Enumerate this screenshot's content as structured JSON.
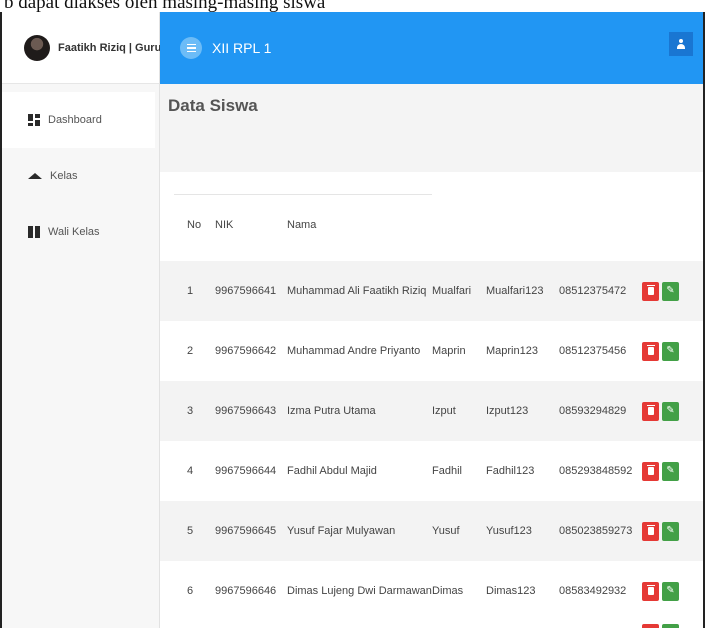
{
  "caption": "b dapat diakses oleh masing-masing siswa",
  "sidebar": {
    "profile_name": "Faatikh Riziq | Guru",
    "items": [
      {
        "label": "Dashboard",
        "icon": "dashboard-icon"
      },
      {
        "label": "Kelas",
        "icon": "graduation-cap-icon"
      },
      {
        "label": "Wali Kelas",
        "icon": "columns-icon"
      }
    ]
  },
  "header": {
    "title": "XII RPL 1",
    "menu_icon": "menu-icon",
    "user_icon": "user-icon",
    "accent_color": "#2196f3"
  },
  "main": {
    "page_title": "Data Siswa",
    "table": {
      "columns": [
        "No",
        "NIK",
        "Nama"
      ],
      "rows": [
        {
          "no": "1",
          "nik": "9967596641",
          "nama": "Muhammad Ali Faatikh Riziq",
          "username": "Mualfari",
          "password": "Mualfari123",
          "telp": "08512375472"
        },
        {
          "no": "2",
          "nik": "9967596642",
          "nama": "Muhammad Andre Priyanto",
          "username": "Maprin",
          "password": "Maprin123",
          "telp": "08512375456"
        },
        {
          "no": "3",
          "nik": "9967596643",
          "nama": "Izma Putra Utama",
          "username": "Izput",
          "password": "Izput123",
          "telp": "08593294829"
        },
        {
          "no": "4",
          "nik": "9967596644",
          "nama": "Fadhil Abdul Majid",
          "username": "Fadhil",
          "password": "Fadhil123",
          "telp": "085293848592"
        },
        {
          "no": "5",
          "nik": "9967596645",
          "nama": "Yusuf Fajar Mulyawan",
          "username": "Yusuf",
          "password": "Yusuf123",
          "telp": "085023859273"
        },
        {
          "no": "6",
          "nik": "9967596646",
          "nama": "Dimas Lujeng Dwi Darmawan",
          "username": "Dimas",
          "password": "Dimas123",
          "telp": "08583492932"
        }
      ],
      "delete_color": "#e53935",
      "edit_color": "#43a047"
    }
  }
}
